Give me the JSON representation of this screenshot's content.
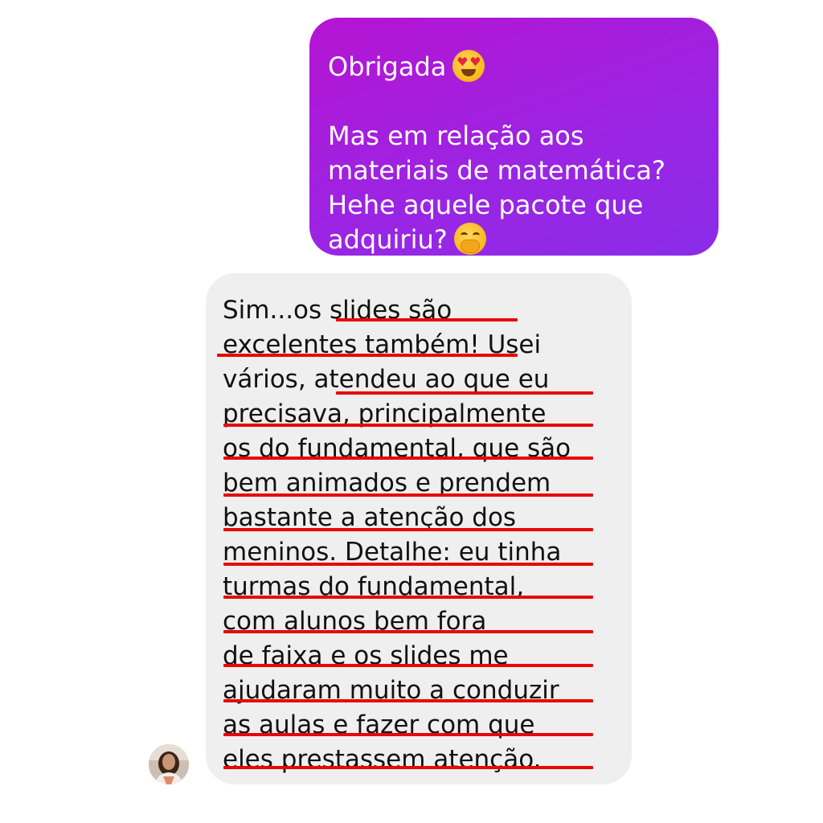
{
  "sent_message": {
    "line1": "Obrigada",
    "line1_emoji": "smiling-face-with-heart-eyes",
    "line2": "Mas em relação aos",
    "line3": "materiais de matemática?",
    "line4": "Hehe aquele pacote que",
    "line5": "adquiriu?",
    "line5_emoji": "face-with-hand-over-mouth",
    "gradient_colors": [
      "#b514d2",
      "#8a2ce8"
    ]
  },
  "received_message": {
    "lines": [
      "Sim...os slides são",
      "excelentes também! Usei",
      "vários, atendeu ao que eu",
      "precisava, principalmente",
      "os do fundamental, que são",
      "bem animados e prendem",
      "bastante a atenção dos",
      "meninos. Detalhe: eu tinha",
      "turmas do fundamental,",
      "com alunos bem fora",
      "de faixa e os slides me",
      "ajudaram muito a conduzir",
      "as aulas e fazer com que",
      "eles prestassem atenção."
    ],
    "highlight_color": "#e80808",
    "background": "#efefef"
  },
  "sender_avatar": {
    "icon": "profile-avatar"
  }
}
